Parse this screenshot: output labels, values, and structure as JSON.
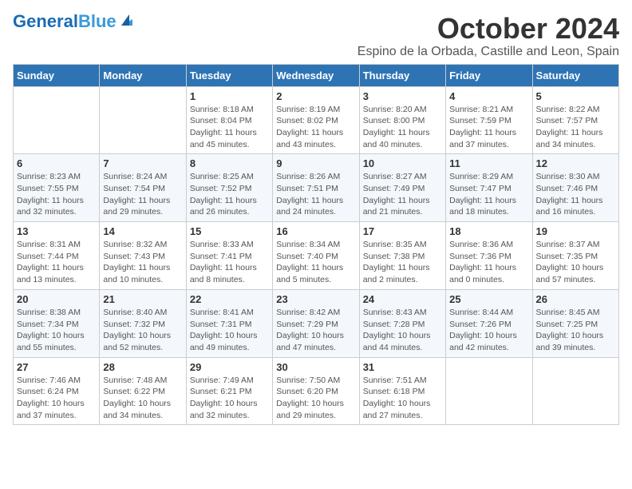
{
  "header": {
    "logo_general": "General",
    "logo_blue": "Blue",
    "month": "October 2024",
    "location": "Espino de la Orbada, Castille and Leon, Spain"
  },
  "weekdays": [
    "Sunday",
    "Monday",
    "Tuesday",
    "Wednesday",
    "Thursday",
    "Friday",
    "Saturday"
  ],
  "rows": [
    [
      {
        "day": "",
        "info": ""
      },
      {
        "day": "",
        "info": ""
      },
      {
        "day": "1",
        "info": "Sunrise: 8:18 AM\nSunset: 8:04 PM\nDaylight: 11 hours and 45 minutes."
      },
      {
        "day": "2",
        "info": "Sunrise: 8:19 AM\nSunset: 8:02 PM\nDaylight: 11 hours and 43 minutes."
      },
      {
        "day": "3",
        "info": "Sunrise: 8:20 AM\nSunset: 8:00 PM\nDaylight: 11 hours and 40 minutes."
      },
      {
        "day": "4",
        "info": "Sunrise: 8:21 AM\nSunset: 7:59 PM\nDaylight: 11 hours and 37 minutes."
      },
      {
        "day": "5",
        "info": "Sunrise: 8:22 AM\nSunset: 7:57 PM\nDaylight: 11 hours and 34 minutes."
      }
    ],
    [
      {
        "day": "6",
        "info": "Sunrise: 8:23 AM\nSunset: 7:55 PM\nDaylight: 11 hours and 32 minutes."
      },
      {
        "day": "7",
        "info": "Sunrise: 8:24 AM\nSunset: 7:54 PM\nDaylight: 11 hours and 29 minutes."
      },
      {
        "day": "8",
        "info": "Sunrise: 8:25 AM\nSunset: 7:52 PM\nDaylight: 11 hours and 26 minutes."
      },
      {
        "day": "9",
        "info": "Sunrise: 8:26 AM\nSunset: 7:51 PM\nDaylight: 11 hours and 24 minutes."
      },
      {
        "day": "10",
        "info": "Sunrise: 8:27 AM\nSunset: 7:49 PM\nDaylight: 11 hours and 21 minutes."
      },
      {
        "day": "11",
        "info": "Sunrise: 8:29 AM\nSunset: 7:47 PM\nDaylight: 11 hours and 18 minutes."
      },
      {
        "day": "12",
        "info": "Sunrise: 8:30 AM\nSunset: 7:46 PM\nDaylight: 11 hours and 16 minutes."
      }
    ],
    [
      {
        "day": "13",
        "info": "Sunrise: 8:31 AM\nSunset: 7:44 PM\nDaylight: 11 hours and 13 minutes."
      },
      {
        "day": "14",
        "info": "Sunrise: 8:32 AM\nSunset: 7:43 PM\nDaylight: 11 hours and 10 minutes."
      },
      {
        "day": "15",
        "info": "Sunrise: 8:33 AM\nSunset: 7:41 PM\nDaylight: 11 hours and 8 minutes."
      },
      {
        "day": "16",
        "info": "Sunrise: 8:34 AM\nSunset: 7:40 PM\nDaylight: 11 hours and 5 minutes."
      },
      {
        "day": "17",
        "info": "Sunrise: 8:35 AM\nSunset: 7:38 PM\nDaylight: 11 hours and 2 minutes."
      },
      {
        "day": "18",
        "info": "Sunrise: 8:36 AM\nSunset: 7:36 PM\nDaylight: 11 hours and 0 minutes."
      },
      {
        "day": "19",
        "info": "Sunrise: 8:37 AM\nSunset: 7:35 PM\nDaylight: 10 hours and 57 minutes."
      }
    ],
    [
      {
        "day": "20",
        "info": "Sunrise: 8:38 AM\nSunset: 7:34 PM\nDaylight: 10 hours and 55 minutes."
      },
      {
        "day": "21",
        "info": "Sunrise: 8:40 AM\nSunset: 7:32 PM\nDaylight: 10 hours and 52 minutes."
      },
      {
        "day": "22",
        "info": "Sunrise: 8:41 AM\nSunset: 7:31 PM\nDaylight: 10 hours and 49 minutes."
      },
      {
        "day": "23",
        "info": "Sunrise: 8:42 AM\nSunset: 7:29 PM\nDaylight: 10 hours and 47 minutes."
      },
      {
        "day": "24",
        "info": "Sunrise: 8:43 AM\nSunset: 7:28 PM\nDaylight: 10 hours and 44 minutes."
      },
      {
        "day": "25",
        "info": "Sunrise: 8:44 AM\nSunset: 7:26 PM\nDaylight: 10 hours and 42 minutes."
      },
      {
        "day": "26",
        "info": "Sunrise: 8:45 AM\nSunset: 7:25 PM\nDaylight: 10 hours and 39 minutes."
      }
    ],
    [
      {
        "day": "27",
        "info": "Sunrise: 7:46 AM\nSunset: 6:24 PM\nDaylight: 10 hours and 37 minutes."
      },
      {
        "day": "28",
        "info": "Sunrise: 7:48 AM\nSunset: 6:22 PM\nDaylight: 10 hours and 34 minutes."
      },
      {
        "day": "29",
        "info": "Sunrise: 7:49 AM\nSunset: 6:21 PM\nDaylight: 10 hours and 32 minutes."
      },
      {
        "day": "30",
        "info": "Sunrise: 7:50 AM\nSunset: 6:20 PM\nDaylight: 10 hours and 29 minutes."
      },
      {
        "day": "31",
        "info": "Sunrise: 7:51 AM\nSunset: 6:18 PM\nDaylight: 10 hours and 27 minutes."
      },
      {
        "day": "",
        "info": ""
      },
      {
        "day": "",
        "info": ""
      }
    ]
  ]
}
